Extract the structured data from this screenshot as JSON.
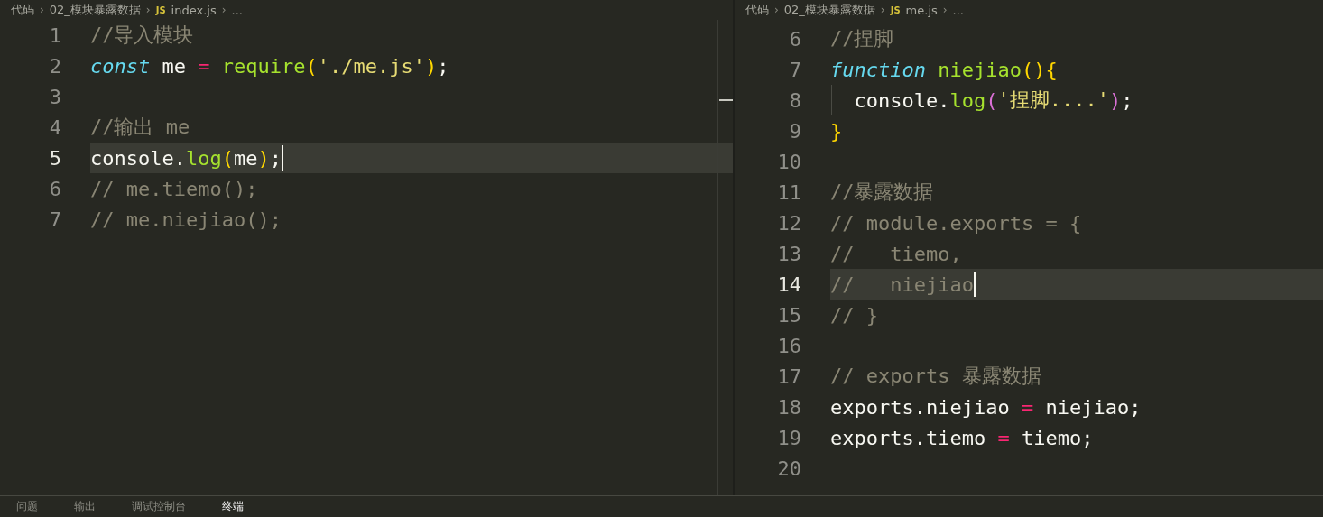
{
  "panes": [
    {
      "breadcrumbs": [
        {
          "kind": "folder",
          "text": "代码"
        },
        {
          "kind": "separator",
          "text": "›"
        },
        {
          "kind": "folder",
          "text": "02_模块暴露数据"
        },
        {
          "kind": "separator",
          "text": "›"
        },
        {
          "kind": "file",
          "badge": "JS",
          "text": "index.js"
        },
        {
          "kind": "separator",
          "text": "›"
        },
        {
          "kind": "more",
          "text": "..."
        }
      ],
      "lines": [
        {
          "number": "1",
          "current": false,
          "cursor": false,
          "indent_guide": false,
          "tokens": [
            {
              "kind": "comment",
              "text": "//导入模块"
            }
          ]
        },
        {
          "number": "2",
          "current": false,
          "cursor": false,
          "indent_guide": false,
          "tokens": [
            {
              "kind": "keyword",
              "text": "const"
            },
            {
              "kind": "plain",
              "text": " me "
            },
            {
              "kind": "op",
              "text": "="
            },
            {
              "kind": "func",
              "text": " require"
            },
            {
              "kind": "bracket1",
              "text": "("
            },
            {
              "kind": "string",
              "text": "'./me.js'"
            },
            {
              "kind": "bracket1",
              "text": ")"
            },
            {
              "kind": "plain",
              "text": ";"
            }
          ]
        },
        {
          "number": "3",
          "current": false,
          "cursor": false,
          "indent_guide": false
        },
        {
          "number": "4",
          "current": false,
          "cursor": false,
          "indent_guide": false,
          "tokens": [
            {
              "kind": "comment",
              "text": "//输出 me"
            }
          ]
        },
        {
          "number": "5",
          "current": true,
          "cursor": true,
          "indent_guide": false,
          "tokens": [
            {
              "kind": "plain",
              "text": "console."
            },
            {
              "kind": "func",
              "text": "log"
            },
            {
              "kind": "bracket1",
              "text": "("
            },
            {
              "kind": "plain",
              "text": "me"
            },
            {
              "kind": "bracket1",
              "text": ")"
            },
            {
              "kind": "plain",
              "text": ";"
            }
          ]
        },
        {
          "number": "6",
          "current": false,
          "cursor": false,
          "indent_guide": false,
          "tokens": [
            {
              "kind": "comment",
              "text": "// me.tiemo();"
            }
          ]
        },
        {
          "number": "7",
          "current": false,
          "cursor": false,
          "indent_guide": false,
          "tokens": [
            {
              "kind": "comment",
              "text": "// me.niejiao();"
            }
          ]
        }
      ]
    },
    {
      "breadcrumbs": [
        {
          "kind": "folder",
          "text": "代码"
        },
        {
          "kind": "separator",
          "text": "›"
        },
        {
          "kind": "folder",
          "text": "02_模块暴露数据"
        },
        {
          "kind": "separator",
          "text": "›"
        },
        {
          "kind": "file",
          "badge": "JS",
          "text": "me.js"
        },
        {
          "kind": "separator",
          "text": "›"
        },
        {
          "kind": "more",
          "text": "..."
        }
      ],
      "lines": [
        {
          "number": "6",
          "current": false,
          "cursor": false,
          "indent_guide": false,
          "tokens": [
            {
              "kind": "comment",
              "text": "//捏脚"
            }
          ]
        },
        {
          "number": "7",
          "current": false,
          "cursor": false,
          "indent_guide": false,
          "tokens": [
            {
              "kind": "keyword",
              "text": "function"
            },
            {
              "kind": "func",
              "text": " niejiao"
            },
            {
              "kind": "bracket1",
              "text": "(){"
            }
          ]
        },
        {
          "number": "8",
          "current": false,
          "cursor": false,
          "indent_guide": true,
          "tokens": [
            {
              "kind": "plain",
              "text": "  console."
            },
            {
              "kind": "func",
              "text": "log"
            },
            {
              "kind": "bracket2",
              "text": "("
            },
            {
              "kind": "string",
              "text": "'捏脚....'"
            },
            {
              "kind": "bracket2",
              "text": ")"
            },
            {
              "kind": "plain",
              "text": ";"
            }
          ]
        },
        {
          "number": "9",
          "current": false,
          "cursor": false,
          "indent_guide": false,
          "tokens": [
            {
              "kind": "bracket1",
              "text": "}"
            }
          ]
        },
        {
          "number": "10",
          "current": false,
          "cursor": false,
          "indent_guide": false
        },
        {
          "number": "11",
          "current": false,
          "cursor": false,
          "indent_guide": false,
          "tokens": [
            {
              "kind": "comment",
              "text": "//暴露数据"
            }
          ]
        },
        {
          "number": "12",
          "current": false,
          "cursor": false,
          "indent_guide": false,
          "tokens": [
            {
              "kind": "comment",
              "text": "// module.exports = {"
            }
          ]
        },
        {
          "number": "13",
          "current": false,
          "cursor": false,
          "indent_guide": false,
          "tokens": [
            {
              "kind": "comment",
              "text": "//   tiemo,"
            }
          ]
        },
        {
          "number": "14",
          "current": true,
          "cursor": true,
          "indent_guide": false,
          "tokens": [
            {
              "kind": "comment",
              "text": "//   niejiao"
            }
          ]
        },
        {
          "number": "15",
          "current": false,
          "cursor": false,
          "indent_guide": false,
          "tokens": [
            {
              "kind": "comment",
              "text": "// }"
            }
          ]
        },
        {
          "number": "16",
          "current": false,
          "cursor": false,
          "indent_guide": false
        },
        {
          "number": "17",
          "current": false,
          "cursor": false,
          "indent_guide": false,
          "tokens": [
            {
              "kind": "comment",
              "text": "// exports 暴露数据"
            }
          ]
        },
        {
          "number": "18",
          "current": false,
          "cursor": false,
          "indent_guide": false,
          "tokens": [
            {
              "kind": "plain",
              "text": "exports.niejiao "
            },
            {
              "kind": "op",
              "text": "="
            },
            {
              "kind": "plain",
              "text": " niejiao;"
            }
          ]
        },
        {
          "number": "19",
          "current": false,
          "cursor": false,
          "indent_guide": false,
          "tokens": [
            {
              "kind": "plain",
              "text": "exports.tiemo "
            },
            {
              "kind": "op",
              "text": "="
            },
            {
              "kind": "plain",
              "text": " tiemo;"
            }
          ]
        },
        {
          "number": "20",
          "current": false,
          "cursor": false,
          "indent_guide": false
        }
      ]
    }
  ],
  "panel_tabs": [
    {
      "label": "问题",
      "selected": false
    },
    {
      "label": "输出",
      "selected": false
    },
    {
      "label": "调试控制台",
      "selected": false
    },
    {
      "label": "终端",
      "selected": true
    }
  ]
}
